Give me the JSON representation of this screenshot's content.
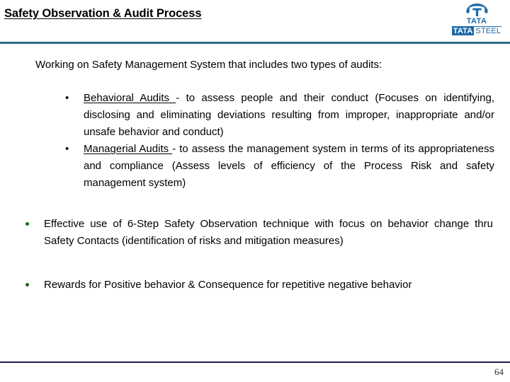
{
  "slide": {
    "title": "Safety Observation & Audit Process",
    "page_number": "64",
    "header_rule_color": "#2e6a8c",
    "footer_rule_color": "#1f1f4a",
    "bullet_color": "#1a6b1a"
  },
  "logo": {
    "mark_name": "tata-logo-mark",
    "brand_top": "TATA",
    "brand_bottom_highlight": "TATA",
    "brand_bottom_rest": "STEEL",
    "brand_color": "#1f6aa8"
  },
  "content": {
    "lead": "Working on Safety Management System that includes two types of audits:",
    "sub_bullets": [
      {
        "marker": "•",
        "term": "Behavioral Audits ",
        "text": "- to assess people and their conduct (Focuses on identifying, disclosing and eliminating deviations resulting from improper, inappropriate and/or unsafe behavior and conduct)"
      },
      {
        "marker": "•",
        "term": "Managerial Audits ",
        "text": "- to assess the management system in terms of its appropriateness and compliance (Assess levels of efficiency of the Process Risk and safety management system)"
      }
    ],
    "dot_bullets": [
      "Effective use of 6-Step Safety Observation technique with focus on behavior change   thru Safety Contacts (identification of risks and mitigation measures)",
      "Rewards for Positive behavior & Consequence for repetitive negative behavior"
    ]
  }
}
